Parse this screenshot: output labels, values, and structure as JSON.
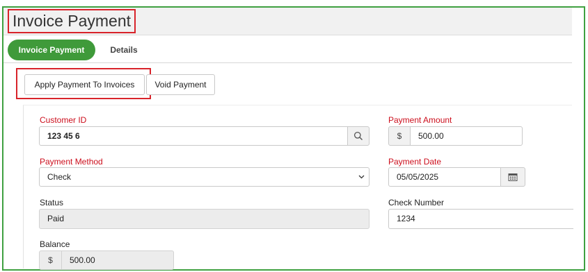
{
  "page": {
    "title": "Invoice Payment"
  },
  "tabs": [
    {
      "label": "Invoice Payment",
      "active": true
    },
    {
      "label": "Details",
      "active": false
    }
  ],
  "actions": {
    "apply_label": "Apply Payment To Invoices",
    "void_label": "Void Payment"
  },
  "form": {
    "customer_id": {
      "label": "Customer ID",
      "value": "123 45 6",
      "icon": "search-icon"
    },
    "payment_amount": {
      "label": "Payment Amount",
      "currency": "$",
      "value": "500.00"
    },
    "payment_method": {
      "label": "Payment Method",
      "value": "Check",
      "icon": "chevron-down-icon"
    },
    "payment_date": {
      "label": "Payment Date",
      "value": "05/05/2025",
      "icon": "calendar-icon"
    },
    "status": {
      "label": "Status",
      "value": "Paid"
    },
    "check_number": {
      "label": "Check Number",
      "value": "1234"
    },
    "balance": {
      "label": "Balance",
      "currency": "$",
      "value": "500.00"
    }
  },
  "colors": {
    "accent": "#3f9a3a",
    "required_label": "#cc0e1c",
    "highlight_box": "#d8232a",
    "frame": "#3fa040"
  }
}
